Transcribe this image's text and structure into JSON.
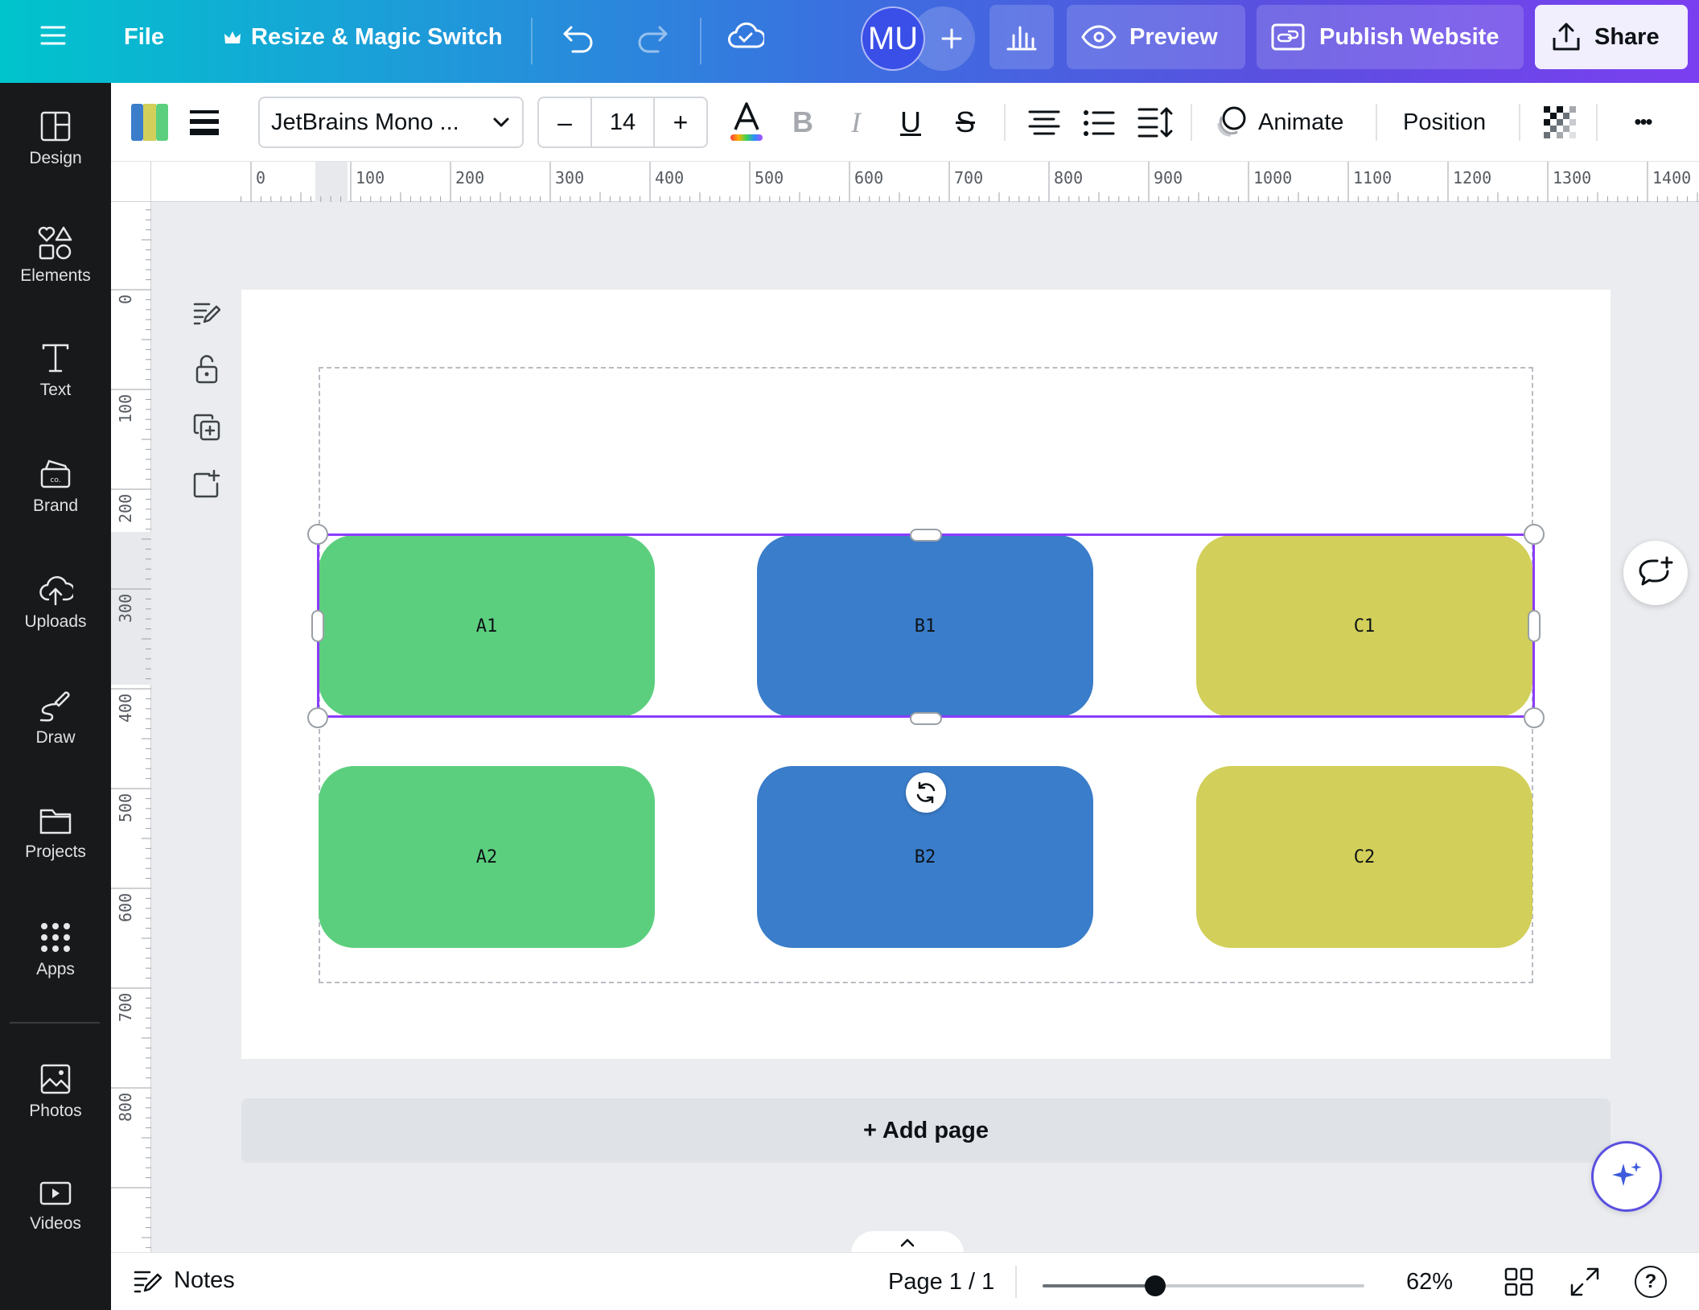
{
  "header": {
    "menu_icon": "hamburger-icon",
    "file_label": "File",
    "resize_label": "Resize & Magic Switch",
    "avatar_initials": "MU",
    "preview_label": "Preview",
    "publish_label": "Publish Website",
    "share_label": "Share"
  },
  "rail": {
    "items": [
      {
        "label": "Design",
        "icon": "layout-icon"
      },
      {
        "label": "Elements",
        "icon": "shapes-icon"
      },
      {
        "label": "Text",
        "icon": "text-icon"
      },
      {
        "label": "Brand",
        "icon": "brand-icon"
      },
      {
        "label": "Uploads",
        "icon": "cloud-upload-icon"
      },
      {
        "label": "Draw",
        "icon": "pen-icon"
      },
      {
        "label": "Projects",
        "icon": "folder-icon"
      },
      {
        "label": "Apps",
        "icon": "grid-icon"
      },
      {
        "label": "Photos",
        "icon": "image-icon"
      },
      {
        "label": "Videos",
        "icon": "video-icon"
      }
    ]
  },
  "toolbar": {
    "font_name": "JetBrains Mono ...",
    "font_size": "14",
    "decrease_label": "–",
    "increase_label": "+",
    "bold_label": "B",
    "italic_label": "I",
    "underline_label": "U",
    "strike_label": "S",
    "animate_label": "Animate",
    "position_label": "Position",
    "more_label": "•••"
  },
  "ruler": {
    "h_ticks": [
      "0",
      "100",
      "200",
      "300",
      "400",
      "500",
      "600",
      "700",
      "800",
      "900",
      "1000",
      "1100",
      "1200",
      "1300",
      "1400"
    ],
    "v_ticks": [
      "0",
      "100",
      "200",
      "300",
      "400",
      "500",
      "600",
      "700",
      "800"
    ]
  },
  "canvas": {
    "cards": [
      {
        "label": "A1",
        "color": "#5ccf7f"
      },
      {
        "label": "B1",
        "color": "#3a7dca"
      },
      {
        "label": "C1",
        "color": "#d2cf5a"
      },
      {
        "label": "A2",
        "color": "#5ccf7f"
      },
      {
        "label": "B2",
        "color": "#3a7dca"
      },
      {
        "label": "C2",
        "color": "#d2cf5a"
      }
    ],
    "selection_color": "#8b3dff"
  },
  "add_page_label": "+ Add page",
  "footer": {
    "notes_label": "Notes",
    "page_indicator": "Page 1 / 1",
    "zoom_percent": 62,
    "zoom_label": "62%",
    "zoom_slider_position": 0.35,
    "help_label": "?"
  }
}
